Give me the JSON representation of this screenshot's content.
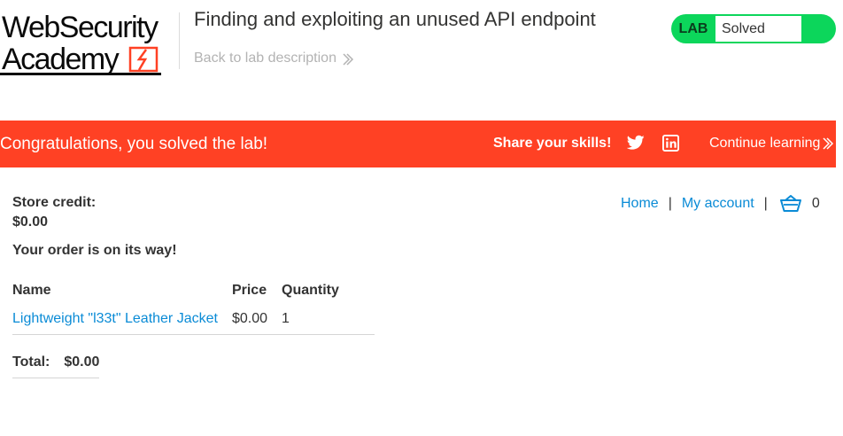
{
  "header": {
    "logo_line1": "WebSecurity",
    "logo_line2": "Academy",
    "lab_title": "Finding and exploiting an unused API endpoint",
    "back_link": "Back to lab description",
    "lab_badge": "LAB",
    "lab_status": "Solved"
  },
  "banner": {
    "congrats": "Congratulations, you solved the lab!",
    "share": "Share your skills!",
    "twitter_icon": "twitter-icon",
    "linkedin_icon": "linkedin-icon",
    "continue": "Continue learning"
  },
  "nav": {
    "home": "Home",
    "separator": "|",
    "my_account": "My account",
    "cart_icon": "cart-icon",
    "cart_count": "0"
  },
  "account": {
    "store_credit_label": "Store credit:",
    "store_credit_value": "$0.00",
    "order_message": "Your order is on its way!"
  },
  "order": {
    "columns": [
      "Name",
      "Price",
      "Quantity"
    ],
    "rows": [
      {
        "name": "Lightweight \"l33t\" Leather Jacket",
        "price": "$0.00",
        "quantity": "1"
      }
    ],
    "total_label": "Total:",
    "total_value": "$0.00"
  },
  "colors": {
    "banner": "#ff4124",
    "lab_green": "#0cd65b",
    "link": "#0a8bd6"
  }
}
